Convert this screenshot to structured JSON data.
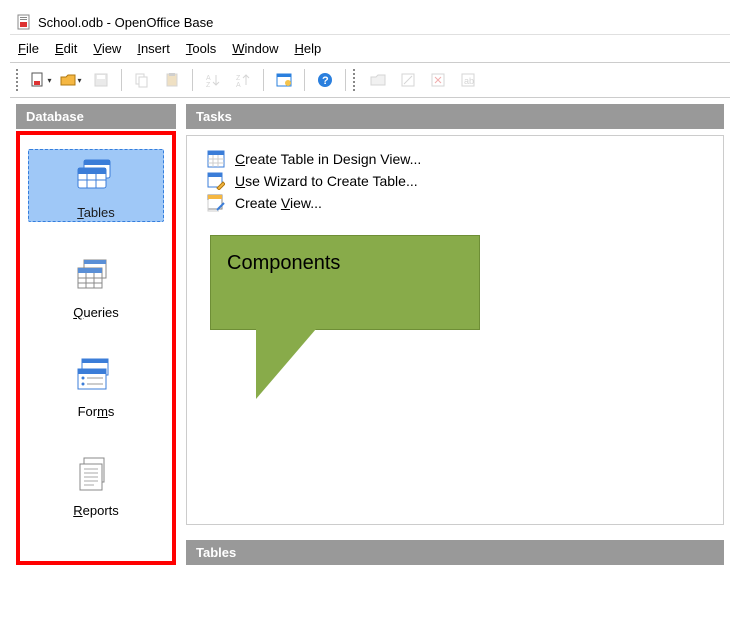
{
  "titlebar": {
    "text": "School.odb - OpenOffice Base"
  },
  "menubar": {
    "file": "File",
    "edit": "Edit",
    "view": "View",
    "insert": "Insert",
    "tools": "Tools",
    "window": "Window",
    "help": "Help"
  },
  "sidebar": {
    "header": "Database",
    "items": [
      {
        "label": "Tables",
        "selected": true
      },
      {
        "label": "Queries",
        "selected": false
      },
      {
        "label": "Forms",
        "selected": false
      },
      {
        "label": "Reports",
        "selected": false
      }
    ]
  },
  "tasks": {
    "header": "Tasks",
    "items": [
      {
        "label": "Create Table in Design View..."
      },
      {
        "label": "Use Wizard to Create Table..."
      },
      {
        "label": "Create View..."
      }
    ]
  },
  "callout": {
    "text": "Components"
  },
  "tables_section": {
    "header": "Tables"
  }
}
